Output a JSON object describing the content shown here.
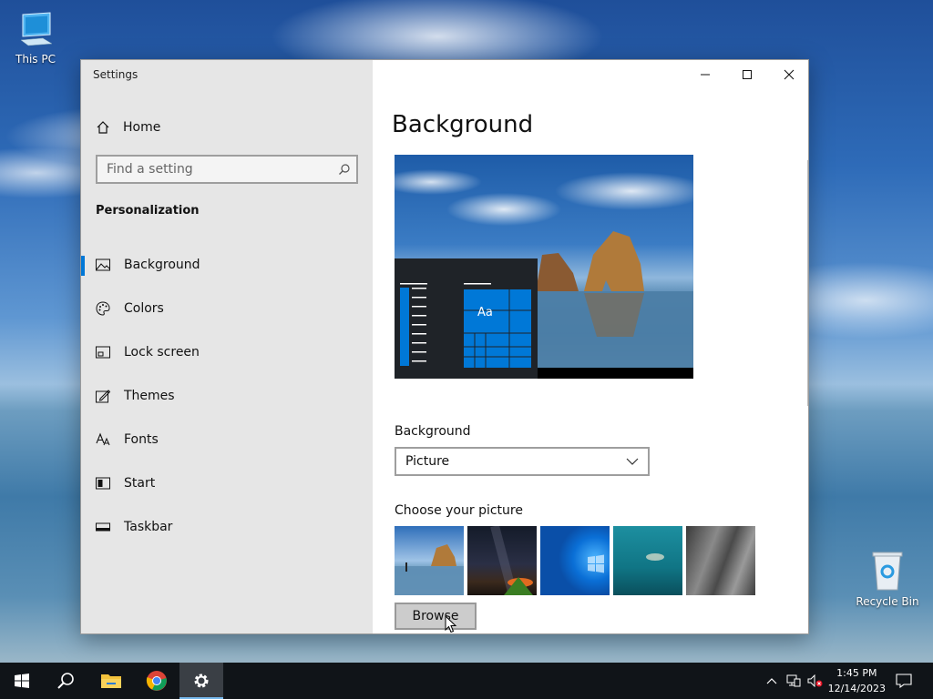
{
  "desktop": {
    "icons": [
      {
        "label": "This PC"
      },
      {
        "label": "Recycle Bin"
      }
    ]
  },
  "window": {
    "title": "Settings",
    "sidebar": {
      "home_label": "Home",
      "search_placeholder": "Find a setting",
      "section_title": "Personalization",
      "items": [
        {
          "label": "Background",
          "icon": "image-icon",
          "active": true
        },
        {
          "label": "Colors",
          "icon": "palette-icon"
        },
        {
          "label": "Lock screen",
          "icon": "lock-screen-icon"
        },
        {
          "label": "Themes",
          "icon": "themes-icon"
        },
        {
          "label": "Fonts",
          "icon": "fonts-icon"
        },
        {
          "label": "Start",
          "icon": "start-icon"
        },
        {
          "label": "Taskbar",
          "icon": "taskbar-icon"
        }
      ]
    },
    "content": {
      "page_title": "Background",
      "preview_tile_label": "Aa",
      "background_label": "Background",
      "background_value": "Picture",
      "choose_picture_label": "Choose your picture",
      "browse_label": "Browse"
    }
  },
  "taskbar": {
    "clock_time": "1:45 PM",
    "clock_date": "12/14/2023"
  },
  "colors": {
    "accent": "#0078d7",
    "sidebar_bg": "#e6e6e6",
    "taskbar_bg": "#101418"
  }
}
